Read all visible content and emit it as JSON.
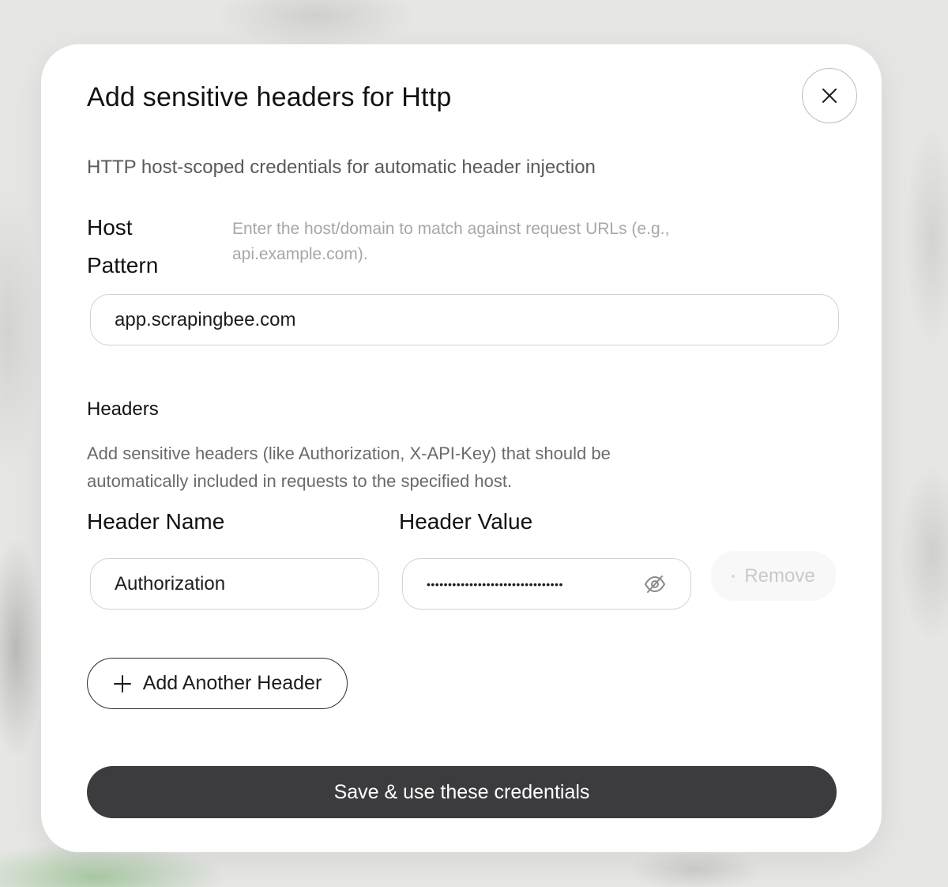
{
  "modal": {
    "title": "Add sensitive headers for Http",
    "subtitle": "HTTP host-scoped credentials for automatic header injection"
  },
  "host": {
    "label": "Host Pattern",
    "hint": "Enter the host/domain to match against request URLs (e.g., api.example.com).",
    "value": "app.scrapingbee.com"
  },
  "headers_section": {
    "title": "Headers",
    "description": "Add sensitive headers (like Authorization, X-API-Key) that should be automatically included in requests to the specified host.",
    "name_label": "Header Name",
    "value_label": "Header Value",
    "rows": [
      {
        "name": "Authorization",
        "masked_value": "••••••••••••••••••••••••••••••••",
        "remove_label": "Remove"
      }
    ]
  },
  "actions": {
    "add_label": "Add Another Header",
    "save_label": "Save & use these credentials"
  },
  "icons": {
    "close": "close-icon",
    "visibility": "eye-off-icon",
    "add": "plus-icon"
  },
  "colors": {
    "primary_button": "#3c3c3f",
    "border": "#d3d3d6",
    "hint_text": "#a7a7ab"
  }
}
